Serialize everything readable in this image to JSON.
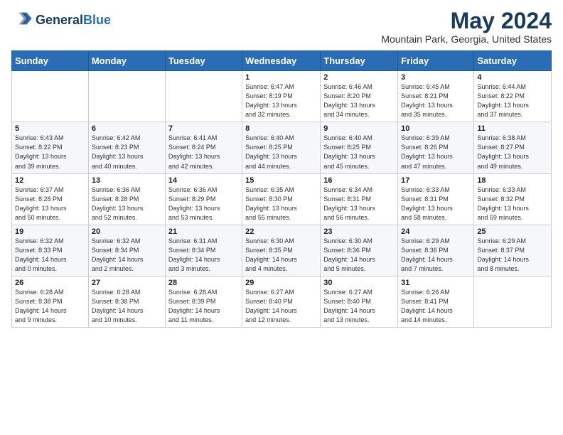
{
  "header": {
    "logo_line1": "General",
    "logo_line2": "Blue",
    "title": "May 2024",
    "subtitle": "Mountain Park, Georgia, United States"
  },
  "days_of_week": [
    "Sunday",
    "Monday",
    "Tuesday",
    "Wednesday",
    "Thursday",
    "Friday",
    "Saturday"
  ],
  "weeks": [
    [
      {
        "day": "",
        "info": ""
      },
      {
        "day": "",
        "info": ""
      },
      {
        "day": "",
        "info": ""
      },
      {
        "day": "1",
        "info": "Sunrise: 6:47 AM\nSunset: 8:19 PM\nDaylight: 13 hours\nand 32 minutes."
      },
      {
        "day": "2",
        "info": "Sunrise: 6:46 AM\nSunset: 8:20 PM\nDaylight: 13 hours\nand 34 minutes."
      },
      {
        "day": "3",
        "info": "Sunrise: 6:45 AM\nSunset: 8:21 PM\nDaylight: 13 hours\nand 35 minutes."
      },
      {
        "day": "4",
        "info": "Sunrise: 6:44 AM\nSunset: 8:22 PM\nDaylight: 13 hours\nand 37 minutes."
      }
    ],
    [
      {
        "day": "5",
        "info": "Sunrise: 6:43 AM\nSunset: 8:22 PM\nDaylight: 13 hours\nand 39 minutes."
      },
      {
        "day": "6",
        "info": "Sunrise: 6:42 AM\nSunset: 8:23 PM\nDaylight: 13 hours\nand 40 minutes."
      },
      {
        "day": "7",
        "info": "Sunrise: 6:41 AM\nSunset: 8:24 PM\nDaylight: 13 hours\nand 42 minutes."
      },
      {
        "day": "8",
        "info": "Sunrise: 6:40 AM\nSunset: 8:25 PM\nDaylight: 13 hours\nand 44 minutes."
      },
      {
        "day": "9",
        "info": "Sunrise: 6:40 AM\nSunset: 8:25 PM\nDaylight: 13 hours\nand 45 minutes."
      },
      {
        "day": "10",
        "info": "Sunrise: 6:39 AM\nSunset: 8:26 PM\nDaylight: 13 hours\nand 47 minutes."
      },
      {
        "day": "11",
        "info": "Sunrise: 6:38 AM\nSunset: 8:27 PM\nDaylight: 13 hours\nand 49 minutes."
      }
    ],
    [
      {
        "day": "12",
        "info": "Sunrise: 6:37 AM\nSunset: 8:28 PM\nDaylight: 13 hours\nand 50 minutes."
      },
      {
        "day": "13",
        "info": "Sunrise: 6:36 AM\nSunset: 8:28 PM\nDaylight: 13 hours\nand 52 minutes."
      },
      {
        "day": "14",
        "info": "Sunrise: 6:36 AM\nSunset: 8:29 PM\nDaylight: 13 hours\nand 53 minutes."
      },
      {
        "day": "15",
        "info": "Sunrise: 6:35 AM\nSunset: 8:30 PM\nDaylight: 13 hours\nand 55 minutes."
      },
      {
        "day": "16",
        "info": "Sunrise: 6:34 AM\nSunset: 8:31 PM\nDaylight: 13 hours\nand 56 minutes."
      },
      {
        "day": "17",
        "info": "Sunrise: 6:33 AM\nSunset: 8:31 PM\nDaylight: 13 hours\nand 58 minutes."
      },
      {
        "day": "18",
        "info": "Sunrise: 6:33 AM\nSunset: 8:32 PM\nDaylight: 13 hours\nand 59 minutes."
      }
    ],
    [
      {
        "day": "19",
        "info": "Sunrise: 6:32 AM\nSunset: 8:33 PM\nDaylight: 14 hours\nand 0 minutes."
      },
      {
        "day": "20",
        "info": "Sunrise: 6:32 AM\nSunset: 8:34 PM\nDaylight: 14 hours\nand 2 minutes."
      },
      {
        "day": "21",
        "info": "Sunrise: 6:31 AM\nSunset: 8:34 PM\nDaylight: 14 hours\nand 3 minutes."
      },
      {
        "day": "22",
        "info": "Sunrise: 6:30 AM\nSunset: 8:35 PM\nDaylight: 14 hours\nand 4 minutes."
      },
      {
        "day": "23",
        "info": "Sunrise: 6:30 AM\nSunset: 8:36 PM\nDaylight: 14 hours\nand 5 minutes."
      },
      {
        "day": "24",
        "info": "Sunrise: 6:29 AM\nSunset: 8:36 PM\nDaylight: 14 hours\nand 7 minutes."
      },
      {
        "day": "25",
        "info": "Sunrise: 6:29 AM\nSunset: 8:37 PM\nDaylight: 14 hours\nand 8 minutes."
      }
    ],
    [
      {
        "day": "26",
        "info": "Sunrise: 6:28 AM\nSunset: 8:38 PM\nDaylight: 14 hours\nand 9 minutes."
      },
      {
        "day": "27",
        "info": "Sunrise: 6:28 AM\nSunset: 8:38 PM\nDaylight: 14 hours\nand 10 minutes."
      },
      {
        "day": "28",
        "info": "Sunrise: 6:28 AM\nSunset: 8:39 PM\nDaylight: 14 hours\nand 11 minutes."
      },
      {
        "day": "29",
        "info": "Sunrise: 6:27 AM\nSunset: 8:40 PM\nDaylight: 14 hours\nand 12 minutes."
      },
      {
        "day": "30",
        "info": "Sunrise: 6:27 AM\nSunset: 8:40 PM\nDaylight: 14 hours\nand 13 minutes."
      },
      {
        "day": "31",
        "info": "Sunrise: 6:26 AM\nSunset: 8:41 PM\nDaylight: 14 hours\nand 14 minutes."
      },
      {
        "day": "",
        "info": ""
      }
    ]
  ]
}
